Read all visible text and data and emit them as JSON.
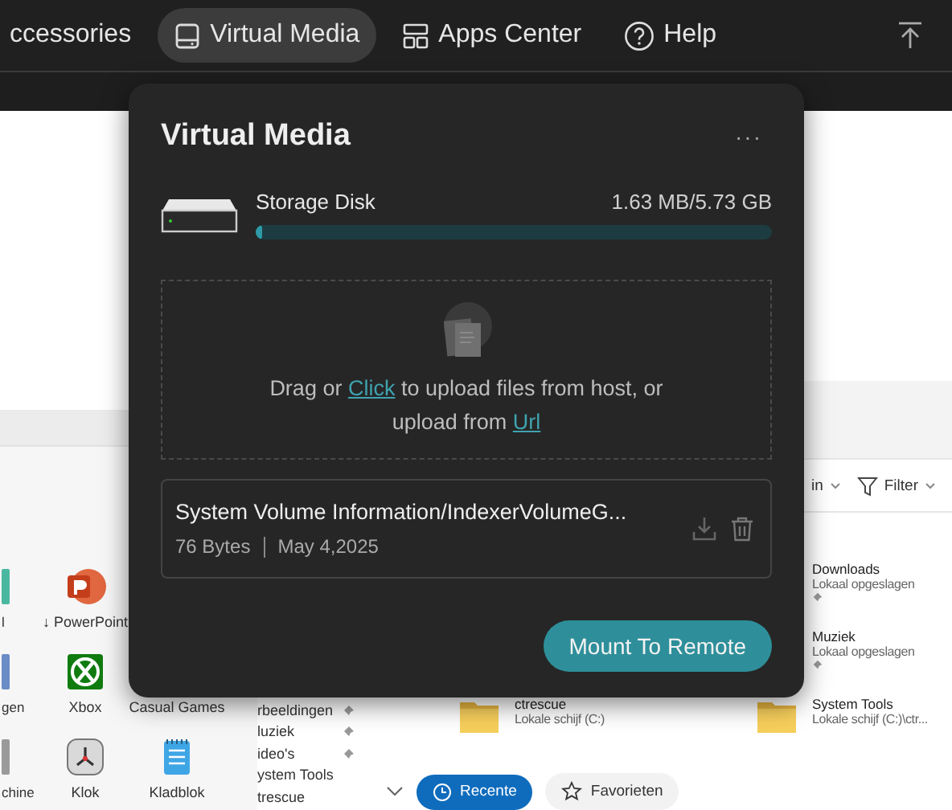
{
  "topbar": {
    "items": [
      {
        "label": "ccessories",
        "kind": "text",
        "selected": false
      },
      {
        "label": "Virtual Media",
        "kind": "drive",
        "selected": true
      },
      {
        "label": "Apps Center",
        "kind": "apps",
        "selected": false
      },
      {
        "label": "Help",
        "kind": "help",
        "selected": false
      }
    ]
  },
  "remote_screen": {
    "start_menu": {
      "rows": [
        [
          {
            "label": "l",
            "kind": "tile"
          },
          {
            "label": "↓ PowerPoint",
            "kind": "powerpoint"
          }
        ],
        [
          {
            "label": "gen",
            "kind": "tile"
          },
          {
            "label": "Xbox",
            "kind": "xbox"
          },
          {
            "label": "Casual Games",
            "kind": "label"
          }
        ],
        [
          {
            "label": "chine",
            "kind": "tile"
          },
          {
            "label": "Klok",
            "kind": "clock"
          },
          {
            "label": "Kladblok",
            "kind": "notepad"
          }
        ]
      ]
    },
    "explorer": {
      "toolbar": [
        {
          "label": "in",
          "kind": "menu"
        },
        {
          "label": "Filter",
          "kind": "filter"
        }
      ],
      "sidebar": [
        {
          "label": "rbeeldingen",
          "pinned": true
        },
        {
          "label": "luziek",
          "pinned": true
        },
        {
          "label": "ideo's",
          "pinned": true
        },
        {
          "label": "ystem Tools",
          "pinned": false
        },
        {
          "label": "trescue",
          "pinned": false
        }
      ],
      "quick_access": [
        [
          {
            "name": "ctrescue",
            "location": "Lokale schijf (C:)",
            "pinned": false,
            "folder": true
          }
        ],
        [
          {
            "name": "Downloads",
            "location": "Lokaal opgeslagen",
            "pinned": true,
            "folder": false
          },
          {
            "name": "Muziek",
            "location": "Lokaal opgeslagen",
            "pinned": true,
            "folder": false
          },
          {
            "name": "System Tools",
            "location": "Lokale schijf (C:)\\ctr...",
            "pinned": false,
            "folder": true
          }
        ]
      ],
      "tabs": [
        {
          "label": "Recente",
          "kind": "clock",
          "selected": true
        },
        {
          "label": "Favorieten",
          "kind": "star",
          "selected": false
        }
      ]
    }
  },
  "popup": {
    "title": "Virtual Media",
    "menu": "···",
    "storage": {
      "name": "Storage Disk",
      "usage": "1.63 MB/5.73 GB",
      "level": 0.004
    },
    "dropzone": {
      "before": "Drag or ",
      "link": "Click",
      "middle": " to upload files from host, or",
      "line2": "upload from ",
      "link2": "Url"
    },
    "files": [
      {
        "name": "System Volume Information/IndexerVolumeG...",
        "size": "76 Bytes",
        "date": "May 4,2025"
      }
    ],
    "button": "Mount To Remote"
  }
}
